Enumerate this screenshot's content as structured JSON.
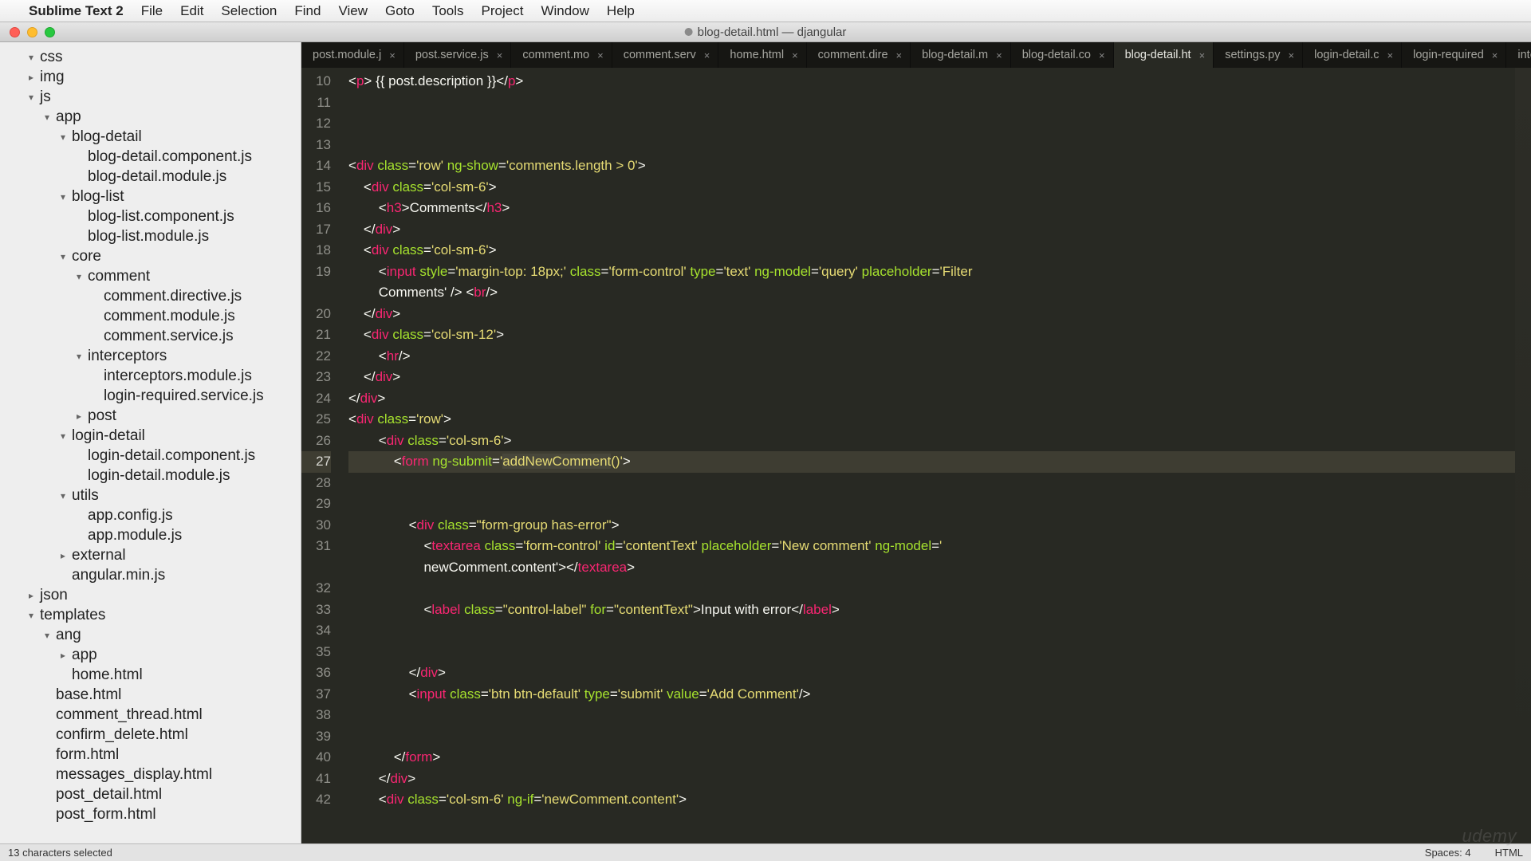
{
  "menubar": {
    "apple": "",
    "appname": "Sublime Text 2",
    "items": [
      "File",
      "Edit",
      "Selection",
      "Find",
      "View",
      "Goto",
      "Tools",
      "Project",
      "Window",
      "Help"
    ]
  },
  "window": {
    "title": "blog-detail.html — djangular"
  },
  "sidebar": {
    "tree": [
      {
        "indent": 1,
        "arrow": "▾",
        "name": "css"
      },
      {
        "indent": 1,
        "arrow": "▸",
        "name": "img"
      },
      {
        "indent": 1,
        "arrow": "▾",
        "name": "js"
      },
      {
        "indent": 2,
        "arrow": "▾",
        "name": "app"
      },
      {
        "indent": 3,
        "arrow": "▾",
        "name": "blog-detail"
      },
      {
        "indent": 4,
        "arrow": "",
        "name": "blog-detail.component.js"
      },
      {
        "indent": 4,
        "arrow": "",
        "name": "blog-detail.module.js"
      },
      {
        "indent": 3,
        "arrow": "▾",
        "name": "blog-list"
      },
      {
        "indent": 4,
        "arrow": "",
        "name": "blog-list.component.js"
      },
      {
        "indent": 4,
        "arrow": "",
        "name": "blog-list.module.js"
      },
      {
        "indent": 3,
        "arrow": "▾",
        "name": "core"
      },
      {
        "indent": 4,
        "arrow": "▾",
        "name": "comment"
      },
      {
        "indent": 5,
        "arrow": "",
        "name": "comment.directive.js"
      },
      {
        "indent": 5,
        "arrow": "",
        "name": "comment.module.js"
      },
      {
        "indent": 5,
        "arrow": "",
        "name": "comment.service.js"
      },
      {
        "indent": 4,
        "arrow": "▾",
        "name": "interceptors"
      },
      {
        "indent": 5,
        "arrow": "",
        "name": "interceptors.module.js"
      },
      {
        "indent": 5,
        "arrow": "",
        "name": "login-required.service.js"
      },
      {
        "indent": 4,
        "arrow": "▸",
        "name": "post"
      },
      {
        "indent": 3,
        "arrow": "▾",
        "name": "login-detail"
      },
      {
        "indent": 4,
        "arrow": "",
        "name": "login-detail.component.js"
      },
      {
        "indent": 4,
        "arrow": "",
        "name": "login-detail.module.js"
      },
      {
        "indent": 3,
        "arrow": "▾",
        "name": "utils"
      },
      {
        "indent": 4,
        "arrow": "",
        "name": "app.config.js"
      },
      {
        "indent": 4,
        "arrow": "",
        "name": "app.module.js"
      },
      {
        "indent": 3,
        "arrow": "▸",
        "name": "external"
      },
      {
        "indent": 3,
        "arrow": "",
        "name": "angular.min.js"
      },
      {
        "indent": 1,
        "arrow": "▸",
        "name": "json"
      },
      {
        "indent": 1,
        "arrow": "▾",
        "name": "templates"
      },
      {
        "indent": 2,
        "arrow": "▾",
        "name": "ang"
      },
      {
        "indent": 3,
        "arrow": "▸",
        "name": "app"
      },
      {
        "indent": 3,
        "arrow": "",
        "name": "home.html"
      },
      {
        "indent": 2,
        "arrow": "",
        "name": "base.html"
      },
      {
        "indent": 2,
        "arrow": "",
        "name": "comment_thread.html"
      },
      {
        "indent": 2,
        "arrow": "",
        "name": "confirm_delete.html"
      },
      {
        "indent": 2,
        "arrow": "",
        "name": "form.html"
      },
      {
        "indent": 2,
        "arrow": "",
        "name": "messages_display.html"
      },
      {
        "indent": 2,
        "arrow": "",
        "name": "post_detail.html"
      },
      {
        "indent": 2,
        "arrow": "",
        "name": "post_form.html"
      }
    ]
  },
  "tabs": [
    {
      "label": "post.module.j",
      "active": false
    },
    {
      "label": "post.service.js",
      "active": false
    },
    {
      "label": "comment.mo",
      "active": false
    },
    {
      "label": "comment.serv",
      "active": false
    },
    {
      "label": "home.html",
      "active": false
    },
    {
      "label": "comment.dire",
      "active": false
    },
    {
      "label": "blog-detail.m",
      "active": false
    },
    {
      "label": "blog-detail.co",
      "active": false
    },
    {
      "label": "blog-detail.ht",
      "active": true
    },
    {
      "label": "settings.py",
      "active": false
    },
    {
      "label": "login-detail.c",
      "active": false
    },
    {
      "label": "login-required",
      "active": false
    },
    {
      "label": "interceptors.n",
      "active": false
    }
  ],
  "code": {
    "first_line_number": 10,
    "active_line": 27,
    "selection_text": "addNewComment",
    "lines_html": [
      "<span class='c-punc'>&lt;</span><span class='c-tag'>p</span><span class='c-punc'>&gt;</span><span class='c-txt'> {{ post.description }}</span><span class='c-punc'>&lt;/</span><span class='c-tag'>p</span><span class='c-punc'>&gt;</span>",
      "",
      "",
      "",
      "<span class='c-punc'>&lt;</span><span class='c-tag'>div</span> <span class='c-attr'>class</span><span class='c-punc'>=</span><span class='c-str'>'row'</span> <span class='c-attr'>ng-show</span><span class='c-punc'>=</span><span class='c-str'>'comments.length &gt; 0'</span><span class='c-punc'>&gt;</span>",
      "    <span class='c-punc'>&lt;</span><span class='c-tag'>div</span> <span class='c-attr'>class</span><span class='c-punc'>=</span><span class='c-str'>'col-sm-6'</span><span class='c-punc'>&gt;</span>",
      "        <span class='c-punc'>&lt;</span><span class='c-tag'>h3</span><span class='c-punc'>&gt;</span><span class='c-txt'>Comments</span><span class='c-punc'>&lt;/</span><span class='c-tag'>h3</span><span class='c-punc'>&gt;</span>",
      "    <span class='c-punc'>&lt;/</span><span class='c-tag'>div</span><span class='c-punc'>&gt;</span>",
      "    <span class='c-punc'>&lt;</span><span class='c-tag'>div</span> <span class='c-attr'>class</span><span class='c-punc'>=</span><span class='c-str'>'col-sm-6'</span><span class='c-punc'>&gt;</span>",
      "        <span class='c-punc'>&lt;</span><span class='c-tag'>input</span> <span class='c-attr'>style</span><span class='c-punc'>=</span><span class='c-str'>'margin-top: 18px;'</span> <span class='c-attr'>class</span><span class='c-punc'>=</span><span class='c-str'>'form-control'</span> <span class='c-attr'>type</span><span class='c-punc'>=</span><span class='c-str'>'text'</span> <span class='c-attr'>ng-model</span><span class='c-punc'>=</span><span class='c-str'>'query'</span> <span class='c-attr'>placeholder</span><span class='c-punc'>=</span><span class='c-str'>'Filter\n        Comments'</span> <span class='c-punc'>/&gt;</span> <span class='c-punc'>&lt;</span><span class='c-tag'>br</span><span class='c-punc'>/&gt;</span>",
      "    <span class='c-punc'>&lt;/</span><span class='c-tag'>div</span><span class='c-punc'>&gt;</span>",
      "    <span class='c-punc'>&lt;</span><span class='c-tag'>div</span> <span class='c-attr'>class</span><span class='c-punc'>=</span><span class='c-str'>'col-sm-12'</span><span class='c-punc'>&gt;</span>",
      "        <span class='c-punc'>&lt;</span><span class='c-tag'>hr</span><span class='c-punc'>/&gt;</span>",
      "    <span class='c-punc'>&lt;/</span><span class='c-tag'>div</span><span class='c-punc'>&gt;</span>",
      "<span class='c-punc'>&lt;/</span><span class='c-tag'>div</span><span class='c-punc'>&gt;</span>",
      "<span class='c-punc'>&lt;</span><span class='c-tag'>div</span> <span class='c-attr'>class</span><span class='c-punc'>=</span><span class='c-str'>'row'</span><span class='c-punc'>&gt;</span>",
      "        <span class='c-punc'>&lt;</span><span class='c-tag'>div</span> <span class='c-attr'>class</span><span class='c-punc'>=</span><span class='c-str'>'col-sm-6'</span><span class='c-punc'>&gt;</span>",
      "            <span class='c-punc'>&lt;</span><span class='c-tag'>form</span> <span class='c-attr'>ng-submit</span><span class='c-punc'>=</span><span class='c-str'>'<span class='sel'>addNewComment</span>()'</span><span class='c-punc'>&gt;</span>",
      "",
      "",
      "                <span class='c-punc'>&lt;</span><span class='c-tag'>div</span> <span class='c-attr'>class</span><span class='c-punc'>=</span><span class='c-str'>\"form-group has-error\"</span><span class='c-punc'>&gt;</span>",
      "                    <span class='c-punc'>&lt;</span><span class='c-tag'>textarea</span> <span class='c-attr'>class</span><span class='c-punc'>=</span><span class='c-str'>'form-control'</span> <span class='c-attr'>id</span><span class='c-punc'>=</span><span class='c-str'>'contentText'</span> <span class='c-attr'>placeholder</span><span class='c-punc'>=</span><span class='c-str'>'New comment'</span> <span class='c-attr'>ng-model</span><span class='c-punc'>=</span><span class='c-str'>'\n                    newComment.content'</span><span class='c-punc'>&gt;&lt;/</span><span class='c-tag'>textarea</span><span class='c-punc'>&gt;</span>",
      "",
      "                    <span class='c-punc'>&lt;</span><span class='c-tag'>label</span> <span class='c-attr'>class</span><span class='c-punc'>=</span><span class='c-str'>\"control-label\"</span> <span class='c-attr'>for</span><span class='c-punc'>=</span><span class='c-str'>\"contentText\"</span><span class='c-punc'>&gt;</span><span class='c-txt'>Input with error</span><span class='c-punc'>&lt;/</span><span class='c-tag'>label</span><span class='c-punc'>&gt;</span>",
      "",
      "",
      "                <span class='c-punc'>&lt;/</span><span class='c-tag'>div</span><span class='c-punc'>&gt;</span>",
      "                <span class='c-punc'>&lt;</span><span class='c-tag'>input</span> <span class='c-attr'>class</span><span class='c-punc'>=</span><span class='c-str'>'btn btn-default'</span> <span class='c-attr'>type</span><span class='c-punc'>=</span><span class='c-str'>'submit'</span> <span class='c-attr'>value</span><span class='c-punc'>=</span><span class='c-str'>'Add Comment'</span><span class='c-punc'>/&gt;</span>",
      "",
      "",
      "            <span class='c-punc'>&lt;/</span><span class='c-tag'>form</span><span class='c-punc'>&gt;</span>",
      "        <span class='c-punc'>&lt;/</span><span class='c-tag'>div</span><span class='c-punc'>&gt;</span>",
      "        <span class='c-punc'>&lt;</span><span class='c-tag'>div</span> <span class='c-attr'>class</span><span class='c-punc'>=</span><span class='c-str'>'col-sm-6'</span> <span class='c-attr'>ng-if</span><span class='c-punc'>=</span><span class='c-str'>'newComment.content'</span><span class='c-punc'>&gt;</span>"
    ]
  },
  "statusbar": {
    "left": "13 characters selected",
    "spaces": "Spaces: 4",
    "lang": "HTML"
  },
  "watermark": "udemy"
}
